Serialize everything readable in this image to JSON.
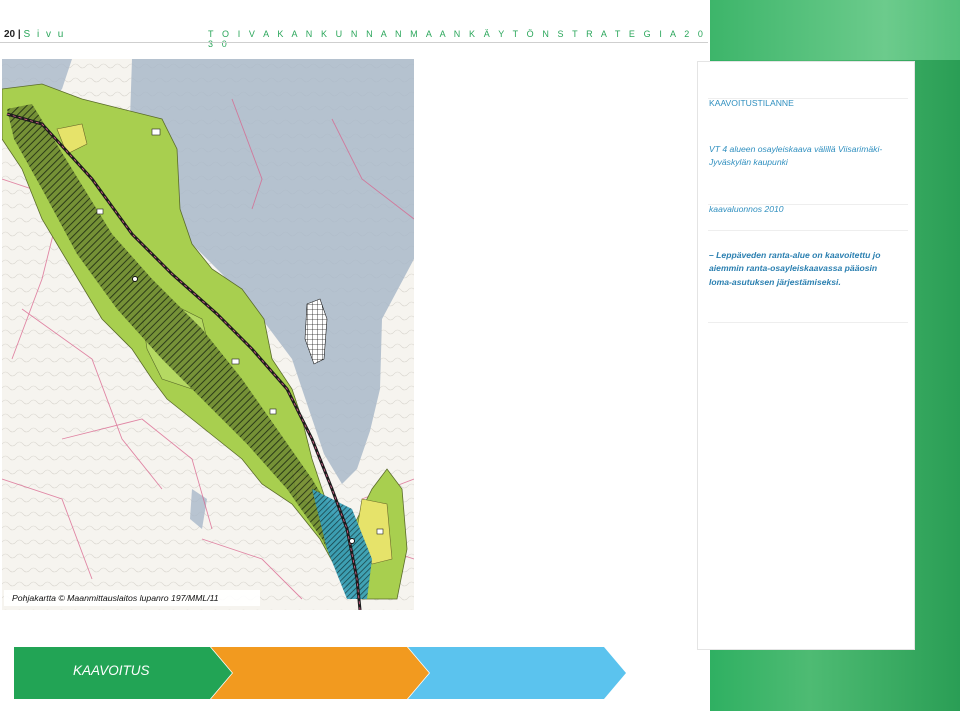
{
  "header": {
    "page_number": "20",
    "separator": "|",
    "page_word": "S i v u",
    "document_title": "T O I V A K A N   K U N N A N   M A A N K Ä Y T Ö N   S T R A T E G I A   2 0 3 0"
  },
  "panel": {
    "heading": "KAAVOITUSTILANNE",
    "plan_line_1": "VT 4 alueen osayleiskaava välillä Viisarimäki-",
    "plan_line_2": "Jyväskylän kaupunki",
    "status": "kaavaluonnos 2010",
    "note_line_1": "– Leppäveden ranta-alue on kaavoitettu jo",
    "note_line_2": "aiemmin ranta-osayleiskaavassa pääosin",
    "note_line_3": "loma-asutuksen järjestämiseksi."
  },
  "map": {
    "credit": "Pohjakartta © Maanmittauslaitos lupanro 197/MML/11"
  },
  "footer": {
    "nav_label": "KAAVOITUS",
    "colors": {
      "arrow_green": "#22a455",
      "arrow_orange": "#f29a1f",
      "arrow_blue": "#5bc3ee"
    }
  }
}
